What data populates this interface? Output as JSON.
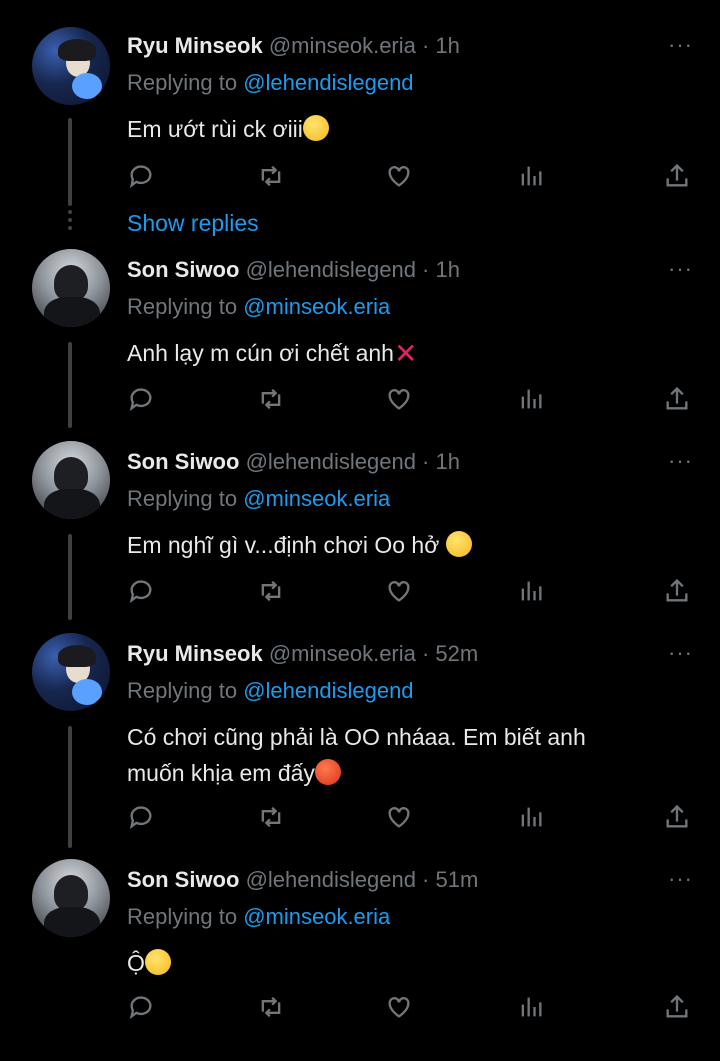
{
  "tweets": [
    {
      "name": "Ryu Minseok",
      "handle": "@minseok.eria · 1h",
      "replying_label": "Replying to ",
      "replying_to": "@lehendislegend",
      "text": "Em ướt rùi ck ơiii",
      "emoji": "hand-over-mouth-emoji"
    },
    {
      "name": "Son Siwoo",
      "handle": "@lehendislegend · 1h",
      "replying_label": "Replying to ",
      "replying_to": "@minseok.eria",
      "text": "Anh lạy m cún ơi chết anh",
      "emoji": "cross-mark-emoji"
    },
    {
      "name": "Son Siwoo",
      "handle": "@lehendislegend · 1h",
      "replying_label": "Replying to ",
      "replying_to": "@minseok.eria",
      "text": "Em nghĩ gì v...định chơi Oo hở ",
      "emoji": "raised-eyebrow-emoji"
    },
    {
      "name": "Ryu Minseok",
      "handle": "@minseok.eria · 52m",
      "replying_label": "Replying to ",
      "replying_to": "@lehendislegend",
      "text_line1": "Có chơi cũng phải là OO nháaa. Em biết anh",
      "text_line2": "muốn khịa em đấy",
      "emoji": "angry-face-emoji"
    },
    {
      "name": "Son Siwoo",
      "handle": "@lehendislegend · 51m",
      "replying_label": "Replying to ",
      "replying_to": "@minseok.eria",
      "text": "Ộ",
      "emoji": "zany-face-emoji"
    }
  ],
  "show_replies": "Show replies",
  "more": "···",
  "action_icons": [
    "reply-icon",
    "retweet-icon",
    "like-icon",
    "views-icon",
    "share-icon"
  ],
  "colors": {
    "accent": "#1d9bf0",
    "muted": "#71767b",
    "background": "#000000"
  }
}
